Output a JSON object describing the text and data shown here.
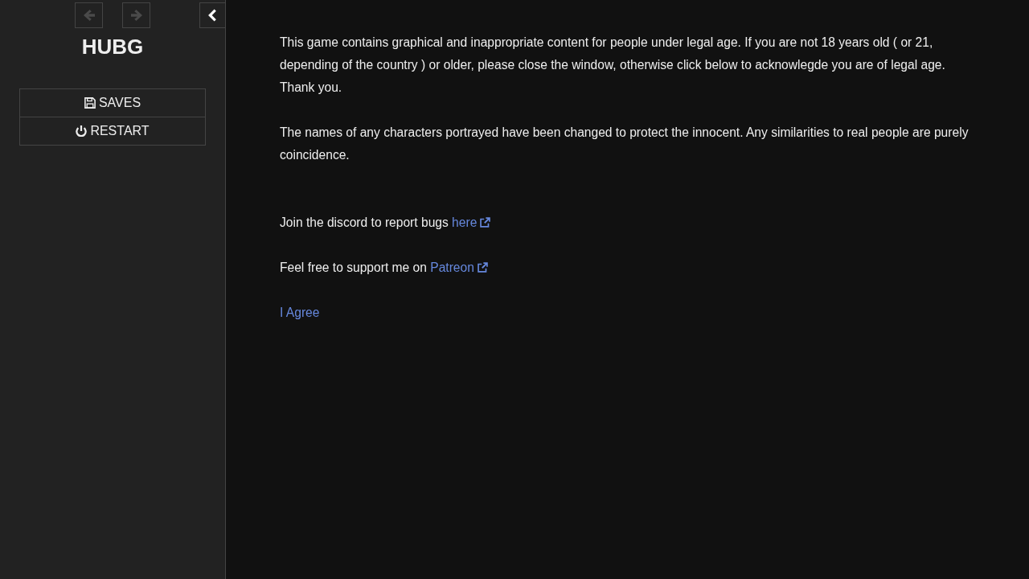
{
  "sidebar": {
    "history": [
      {
        "kind": "back",
        "disabled": true
      },
      {
        "kind": "forward",
        "disabled": true
      }
    ],
    "toggle": {
      "expanded": true
    },
    "title": "HUBG",
    "menu": [
      {
        "kind": "saves",
        "label": "SAVES"
      },
      {
        "kind": "restart",
        "label": "RESTART"
      }
    ]
  },
  "passage": {
    "notice": [
      "This game contains graphical and inappropriate content for people under legal age. If you are not 18 years old ( or 21, depending of the country ) or older, please close the window, otherwise click below to acknowlegde you are of legal age. Thank you.",
      "The names of any characters portrayed have been changed to protect the innocent. Any similarities to real people are purely coincidence."
    ],
    "links": [
      {
        "text": "Join the discord to report bugs",
        "link": "here",
        "external": true
      },
      {
        "text": "Feel free to support me on",
        "link": "Patreon",
        "external": true
      }
    ],
    "agree": {
      "label": "I Agree"
    }
  }
}
